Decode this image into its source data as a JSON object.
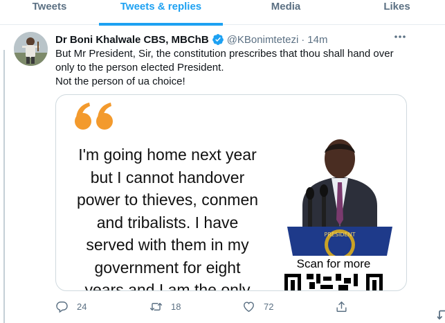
{
  "tabs": [
    {
      "label": "Tweets",
      "active": false
    },
    {
      "label": "Tweets & replies",
      "active": true
    },
    {
      "label": "Media",
      "active": false
    },
    {
      "label": "Likes",
      "active": false
    }
  ],
  "tweet": {
    "author_name": "Dr Boni Khalwale CBS, MBChB",
    "verified_icon": "verified-badge-icon",
    "handle": "@KBonimtetezi",
    "separator": "·",
    "time": "14m",
    "more_icon": "more-icon",
    "text_lines": [
      "But Mr President, Sir, the constitution prescribes that thou shall hand over only to the person elected President.",
      "Not the person of ua choice!"
    ],
    "media": {
      "quote_lines": [
        "I'm going home next year",
        "but I cannot handover",
        "power to thieves, conmen",
        "and tribalists. I have",
        "served with them in my",
        "government for eight",
        "years and I am the only"
      ],
      "scan_label": "Scan for more",
      "accent_color": "#f39a2d"
    },
    "actions": {
      "reply_count": "24",
      "retweet_count": "18",
      "like_count": "72"
    }
  },
  "colors": {
    "accent": "#1da1f2",
    "secondary_text": "#5b7083",
    "border": "#cfd9de"
  }
}
